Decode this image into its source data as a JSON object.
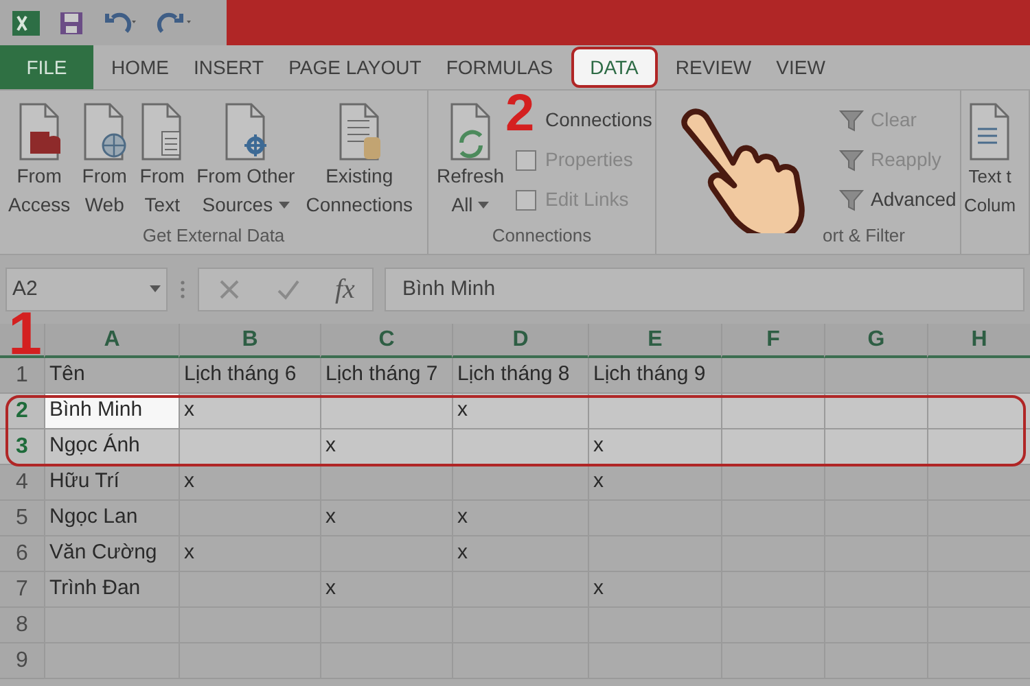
{
  "tabs": [
    {
      "label": "FILE",
      "kind": "file",
      "selected": false
    },
    {
      "label": "HOME",
      "kind": "tab",
      "selected": false
    },
    {
      "label": "INSERT",
      "kind": "tab",
      "selected": false
    },
    {
      "label": "PAGE LAYOUT",
      "kind": "tab",
      "selected": false
    },
    {
      "label": "FORMULAS",
      "kind": "tab",
      "selected": false
    },
    {
      "label": "DATA",
      "kind": "tab",
      "selected": true
    },
    {
      "label": "REVIEW",
      "kind": "tab",
      "selected": false
    },
    {
      "label": "VIEW",
      "kind": "tab",
      "selected": false
    }
  ],
  "ribbon": {
    "groups": [
      {
        "label": "Get External Data",
        "buttons": [
          {
            "kind": "large",
            "lines": [
              "From",
              "Access"
            ]
          },
          {
            "kind": "large",
            "lines": [
              "From",
              "Web"
            ]
          },
          {
            "kind": "large",
            "lines": [
              "From",
              "Text"
            ]
          },
          {
            "kind": "large",
            "lines": [
              "From Other",
              "Sources"
            ],
            "has_menu": true
          },
          {
            "kind": "large",
            "lines": [
              "Existing",
              "Connections"
            ]
          }
        ]
      },
      {
        "label": "Connections",
        "buttons": [
          {
            "kind": "large",
            "lines": [
              "Refresh",
              "All"
            ],
            "has_menu": true
          },
          {
            "kind": "small",
            "lines": [
              "Connections"
            ],
            "disabled": false
          },
          {
            "kind": "small",
            "lines": [
              "Properties"
            ],
            "disabled": true
          },
          {
            "kind": "small",
            "lines": [
              "Edit Links"
            ],
            "disabled": true
          }
        ]
      },
      {
        "label": "ort & Filter",
        "buttons": [
          {
            "kind": "small",
            "lines": [
              "Clear"
            ],
            "disabled": true
          },
          {
            "kind": "small",
            "lines": [
              "Reapply"
            ],
            "disabled": true
          },
          {
            "kind": "small",
            "lines": [
              "Advanced"
            ],
            "disabled": false
          }
        ]
      },
      {
        "buttons": [
          {
            "kind": "large",
            "lines": [
              "Text t",
              "Colum"
            ]
          }
        ]
      }
    ]
  },
  "formula_bar": {
    "name_box": "A2",
    "fx": "fx",
    "value": "Bình Minh"
  },
  "columns": [
    {
      "label": "A"
    },
    {
      "label": "B"
    },
    {
      "label": "C"
    },
    {
      "label": "D"
    },
    {
      "label": "E"
    },
    {
      "label": "F"
    },
    {
      "label": "G"
    },
    {
      "label": "H"
    }
  ],
  "rows": [
    {
      "header": "1",
      "selected": false,
      "cells": [
        {
          "text": "Tên",
          "active": false
        },
        {
          "text": "Lịch tháng 6",
          "active": false
        },
        {
          "text": "Lịch tháng 7",
          "active": false
        },
        {
          "text": "Lịch tháng 8",
          "active": false
        },
        {
          "text": "Lịch tháng 9",
          "active": false
        }
      ]
    },
    {
      "header": "2",
      "selected": true,
      "cells": [
        {
          "text": "Bình Minh",
          "active": true
        },
        {
          "text": "x",
          "active": false
        },
        {
          "active": false
        },
        {
          "text": "x",
          "active": false
        },
        {
          "active": false
        }
      ]
    },
    {
      "header": "3",
      "selected": true,
      "cells": [
        {
          "text": "Ngọc Ánh",
          "active": false
        },
        {
          "active": false
        },
        {
          "text": "x",
          "active": false
        },
        {
          "active": false
        },
        {
          "text": "x",
          "active": false
        }
      ]
    },
    {
      "header": "4",
      "selected": false,
      "cells": [
        {
          "text": "Hữu Trí",
          "active": false
        },
        {
          "text": "x",
          "active": false
        },
        {
          "active": false
        },
        {
          "active": false
        },
        {
          "text": "x",
          "active": false
        }
      ]
    },
    {
      "header": "5",
      "selected": false,
      "cells": [
        {
          "text": "Ngọc Lan",
          "active": false
        },
        {
          "active": false
        },
        {
          "text": "x",
          "active": false
        },
        {
          "text": "x",
          "active": false
        },
        {
          "active": false
        }
      ]
    },
    {
      "header": "6",
      "selected": false,
      "cells": [
        {
          "text": "Văn Cường",
          "active": false
        },
        {
          "text": "x",
          "active": false
        },
        {
          "active": false
        },
        {
          "text": "x",
          "active": false
        },
        {
          "active": false
        }
      ]
    },
    {
      "header": "7",
      "selected": false,
      "cells": [
        {
          "text": "Trình Đan",
          "active": false
        },
        {
          "active": false
        },
        {
          "text": "x",
          "active": false
        },
        {
          "active": false
        },
        {
          "text": "x",
          "active": false
        }
      ]
    },
    {
      "header": "8",
      "selected": false
    },
    {
      "header": "9",
      "selected": false
    }
  ],
  "annotations": [
    {
      "kind": "step",
      "text": "1"
    },
    {
      "kind": "step",
      "text": "2"
    }
  ]
}
